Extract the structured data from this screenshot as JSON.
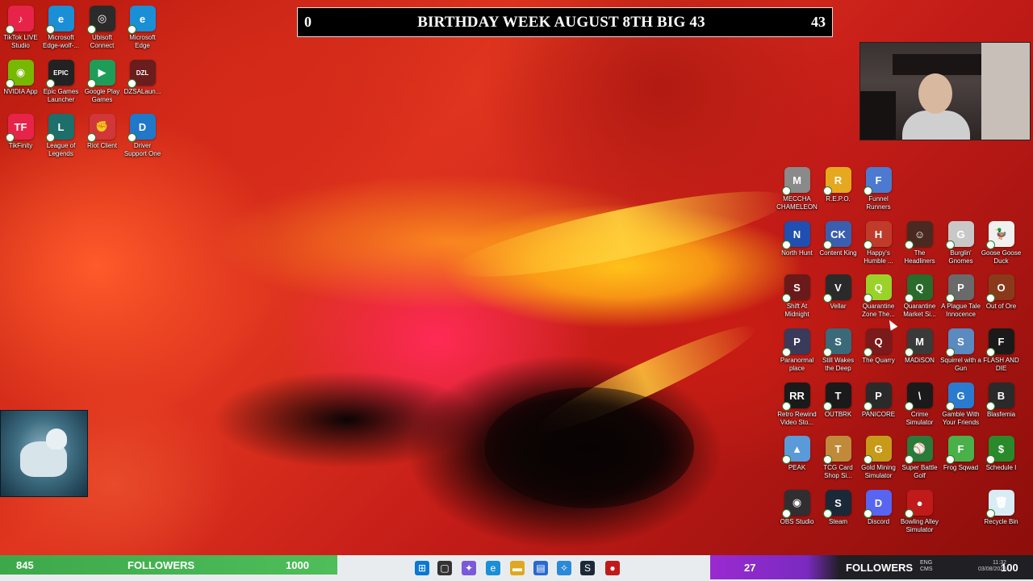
{
  "banner": {
    "left_value": "0",
    "text": "BIRTHDAY WEEK AUGUST 8TH BIG 43",
    "right_value": "43"
  },
  "desktop_left": [
    {
      "label": "TikTok LIVE Studio",
      "icon": "tiktok-icon",
      "color": "#e8234a",
      "glyph": "♪"
    },
    {
      "label": "Microsoft Edge-wolf-...",
      "icon": "edge-icon",
      "color": "#1a8fd6",
      "glyph": "e"
    },
    {
      "label": "Ubisoft Connect",
      "icon": "ubisoft-icon",
      "color": "#2b2b2b",
      "glyph": "◎"
    },
    {
      "label": "Microsoft Edge",
      "icon": "edge-icon",
      "color": "#1a8fd6",
      "glyph": "e"
    },
    {
      "label": "NVIDIA App",
      "icon": "nvidia-icon",
      "color": "#76b900",
      "glyph": "◉"
    },
    {
      "label": "Epic Games Launcher",
      "icon": "epic-icon",
      "color": "#222",
      "glyph": "EPIC"
    },
    {
      "label": "Google Play Games",
      "icon": "play-games-icon",
      "color": "#1e9d58",
      "glyph": "▶"
    },
    {
      "label": "DZSALaun...",
      "icon": "dzsa-icon",
      "color": "#6a1d1d",
      "glyph": "DZL"
    },
    {
      "label": "TikFinity",
      "icon": "tikfinity-icon",
      "color": "#e8234a",
      "glyph": "TF"
    },
    {
      "label": "League of Legends",
      "icon": "lol-icon",
      "color": "#1c6f6a",
      "glyph": "L"
    },
    {
      "label": "Riot Client",
      "icon": "riot-icon",
      "color": "#d13639",
      "glyph": "✊"
    },
    {
      "label": "Driver Support One",
      "icon": "driver-support-icon",
      "color": "#2078c8",
      "glyph": "D"
    }
  ],
  "desktop_right": [
    {
      "label": "MECCHA CHAMELEON",
      "icon": "game-icon",
      "color": "#8a8a8a",
      "glyph": "M"
    },
    {
      "label": "R.E.P.O.",
      "icon": "game-icon",
      "color": "#e5a81e",
      "glyph": "R"
    },
    {
      "label": "Funnel Runners",
      "icon": "game-icon",
      "color": "#4b7ad0",
      "glyph": "F"
    },
    {
      "label": "North Hunt",
      "icon": "game-icon",
      "color": "#1f4fb0",
      "glyph": "N"
    },
    {
      "label": "Content King",
      "icon": "game-icon",
      "color": "#3a5fb0",
      "glyph": "CK"
    },
    {
      "label": "Happy's Humble ...",
      "icon": "game-icon",
      "color": "#c03b2a",
      "glyph": "H"
    },
    {
      "label": "The Headliners",
      "icon": "game-icon",
      "color": "#4a2a20",
      "glyph": "☺"
    },
    {
      "label": "Burglin' Gnomes",
      "icon": "game-icon",
      "color": "#c8c8c8",
      "glyph": "G"
    },
    {
      "label": "Goose Goose Duck",
      "icon": "game-icon",
      "color": "#f0f0f0",
      "glyph": "🦆"
    },
    {
      "label": "Shift At Midnight",
      "icon": "game-icon",
      "color": "#6a1a1a",
      "glyph": "S"
    },
    {
      "label": "Vellar",
      "icon": "game-icon",
      "color": "#2a2a2a",
      "glyph": "V"
    },
    {
      "label": "Quarantine Zone The...",
      "icon": "game-icon",
      "color": "#9bd22a",
      "glyph": "Q"
    },
    {
      "label": "Quarantine Market Si...",
      "icon": "game-icon",
      "color": "#2a6a2a",
      "glyph": "Q"
    },
    {
      "label": "A Plague Tale Innocence",
      "icon": "game-icon",
      "color": "#6a6a6a",
      "glyph": "P"
    },
    {
      "label": "Out of Ore",
      "icon": "game-icon",
      "color": "#8a3a1a",
      "glyph": "O"
    },
    {
      "label": "Paranormal place",
      "icon": "game-icon",
      "color": "#3a3a5a",
      "glyph": "P"
    },
    {
      "label": "Still Wakes the Deep",
      "icon": "game-icon",
      "color": "#3a6a7a",
      "glyph": "S"
    },
    {
      "label": "The Quarry",
      "icon": "game-icon",
      "color": "#7a1a1a",
      "glyph": "Q"
    },
    {
      "label": "MADiSON",
      "icon": "game-icon",
      "color": "#3a3a3a",
      "glyph": "M"
    },
    {
      "label": "Squirrel with a Gun",
      "icon": "game-icon",
      "color": "#5a8ac0",
      "glyph": "S"
    },
    {
      "label": "FLASH AND DIE",
      "icon": "game-icon",
      "color": "#1a1a1a",
      "glyph": "F"
    },
    {
      "label": "Retro Rewind Video Sto...",
      "icon": "game-icon",
      "color": "#1a1a1a",
      "glyph": "RR"
    },
    {
      "label": "OUTBRK",
      "icon": "game-icon",
      "color": "#1a1a1a",
      "glyph": "T"
    },
    {
      "label": "PANICORE",
      "icon": "game-icon",
      "color": "#2a2a2a",
      "glyph": "P"
    },
    {
      "label": "Crime Simulator",
      "icon": "game-icon",
      "color": "#1a1a1a",
      "glyph": "\\"
    },
    {
      "label": "Gamble With Your Friends",
      "icon": "game-icon",
      "color": "#2a7ad0",
      "glyph": "G"
    },
    {
      "label": "Blasfemia",
      "icon": "game-icon",
      "color": "#2a2a2a",
      "glyph": "B"
    },
    {
      "label": "PEAK",
      "icon": "game-icon",
      "color": "#5a9ad8",
      "glyph": "▲"
    },
    {
      "label": "TCG Card Shop Si...",
      "icon": "game-icon",
      "color": "#c08a3a",
      "glyph": "T"
    },
    {
      "label": "Gold Mining Simulator",
      "icon": "game-icon",
      "color": "#c89a1a",
      "glyph": "G"
    },
    {
      "label": "Super Battle Golf",
      "icon": "game-icon",
      "color": "#2a7a3a",
      "glyph": "⚾"
    },
    {
      "label": "Frog Sqwad",
      "icon": "game-icon",
      "color": "#4ab04a",
      "glyph": "F"
    },
    {
      "label": "Schedule I",
      "icon": "game-icon",
      "color": "#2a8a2a",
      "glyph": "$"
    },
    {
      "label": "OBS Studio",
      "icon": "obs-icon",
      "color": "#302e31",
      "glyph": "◉"
    },
    {
      "label": "Steam",
      "icon": "steam-icon",
      "color": "#1b2838",
      "glyph": "S"
    },
    {
      "label": "Discord",
      "icon": "discord-icon",
      "color": "#5865f2",
      "glyph": "D"
    },
    {
      "label": "Bowling Alley Simulator",
      "icon": "game-icon",
      "color": "#c01a1a",
      "glyph": "●"
    },
    {
      "label": "Recycle Bin",
      "icon": "recycle-bin-icon",
      "color": "#d8ecf5",
      "glyph": "🗑"
    }
  ],
  "followers_left": {
    "count": "845",
    "label": "FOLLOWERS",
    "goal": "1000"
  },
  "followers_right": {
    "count": "27",
    "label": "FOLLOWERS",
    "goal": "100"
  },
  "taskbar": [
    {
      "icon": "windows-start-icon",
      "color": "#0a78d4",
      "glyph": "⊞"
    },
    {
      "icon": "task-view-icon",
      "color": "#333",
      "glyph": "▢"
    },
    {
      "icon": "copilot-icon",
      "color": "#7a5ad8",
      "glyph": "✦"
    },
    {
      "icon": "edge-icon",
      "color": "#1a8fd6",
      "glyph": "e"
    },
    {
      "icon": "file-explorer-icon",
      "color": "#e0a820",
      "glyph": "▬"
    },
    {
      "icon": "store-icon",
      "color": "#2a6ad0",
      "glyph": "▤"
    },
    {
      "icon": "vscode-icon",
      "color": "#2a8ad8",
      "glyph": "✧"
    },
    {
      "icon": "steam-icon",
      "color": "#1b2838",
      "glyph": "S"
    },
    {
      "icon": "record-icon",
      "color": "#c01a1a",
      "glyph": "●"
    }
  ],
  "tray": {
    "lang": "ENG",
    "region": "CMS",
    "time": "11:32",
    "date": "03/08/2025"
  }
}
